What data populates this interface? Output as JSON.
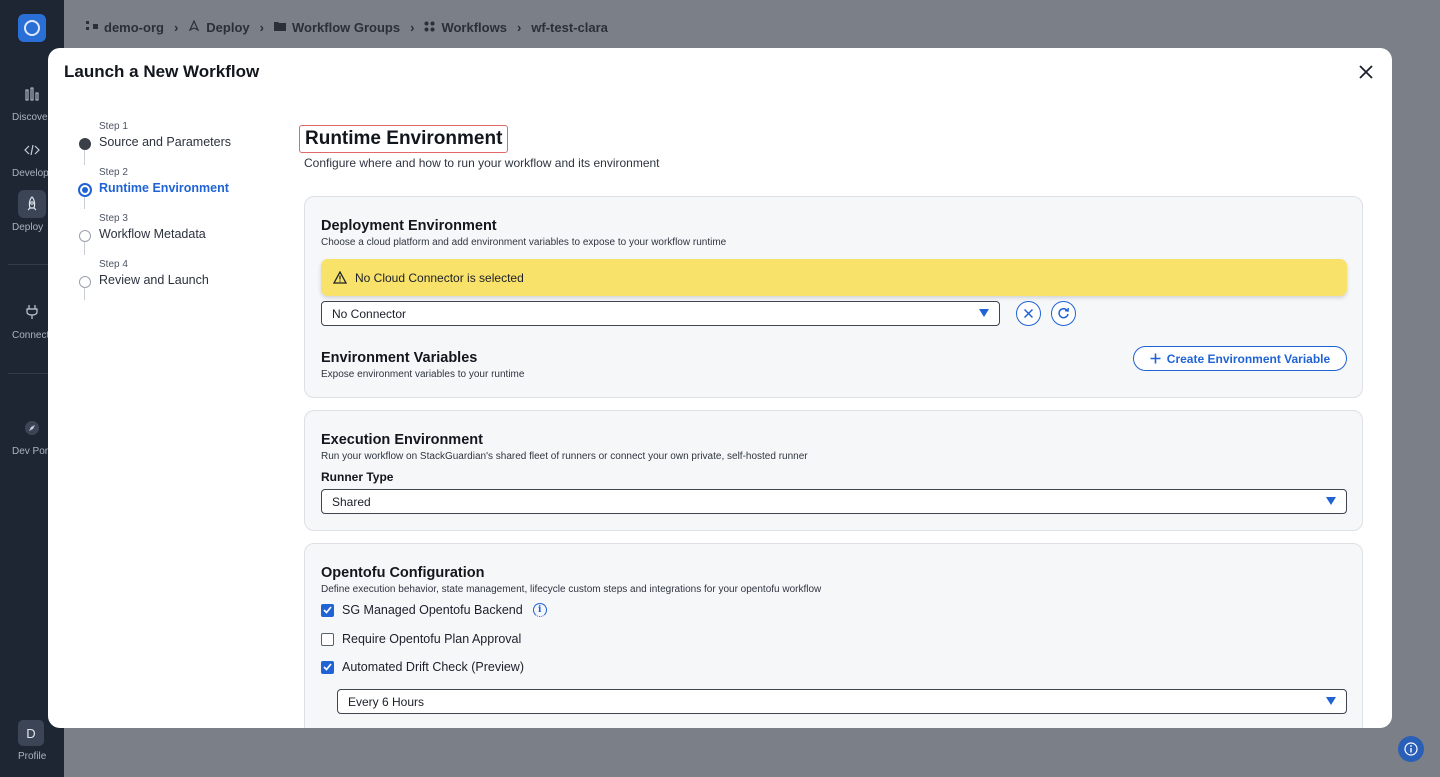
{
  "rail": {
    "items": [
      {
        "label": "Discover",
        "icon": "bar-chart-icon"
      },
      {
        "label": "Develop",
        "icon": "code-icon"
      },
      {
        "label": "Deploy",
        "icon": "rocket-icon"
      },
      {
        "label": "Connectors",
        "icon": "plug-icon"
      },
      {
        "label": "Dev Portal",
        "icon": "compass-icon"
      }
    ],
    "avatar_letter": "D",
    "profile_label": "Profile"
  },
  "breadcrumb": [
    {
      "label": "demo-org",
      "icon": "org-icon"
    },
    {
      "label": "Deploy",
      "icon": "rocket-icon"
    },
    {
      "label": "Workflow Groups",
      "icon": "folder-icon"
    },
    {
      "label": "Workflows",
      "icon": "grid-icon"
    },
    {
      "label": "wf-test-clara",
      "icon": ""
    }
  ],
  "modal": {
    "title": "Launch a New Workflow"
  },
  "steps": [
    {
      "num": "Step 1",
      "label": "Source and Parameters",
      "state": "done"
    },
    {
      "num": "Step 2",
      "label": "Runtime Environment",
      "state": "active"
    },
    {
      "num": "Step 3",
      "label": "Workflow Metadata",
      "state": "pending"
    },
    {
      "num": "Step 4",
      "label": "Review and Launch",
      "state": "pending"
    }
  ],
  "content": {
    "title": "Runtime Environment",
    "subtitle": "Configure where and how to run your workflow and its environment"
  },
  "deployment": {
    "title": "Deployment Environment",
    "desc": "Choose a cloud platform and add environment variables to expose to your workflow runtime",
    "alert": "No Cloud Connector is selected",
    "connector_value": "No Connector",
    "env_title": "Environment Variables",
    "env_desc": "Expose environment variables to your runtime",
    "create_env_label": "Create Environment Variable"
  },
  "execution": {
    "title": "Execution Environment",
    "desc": "Run your workflow on StackGuardian's shared fleet of runners or connect your own private, self-hosted runner",
    "runner_label": "Runner Type",
    "runner_value": "Shared"
  },
  "opentofu": {
    "title": "Opentofu Configuration",
    "desc": "Define execution behavior, state management, lifecycle custom steps and integrations for your opentofu workflow",
    "options": [
      {
        "label": "SG Managed Opentofu Backend",
        "checked": true
      },
      {
        "label": "Require Opentofu Plan Approval",
        "checked": false
      },
      {
        "label": "Automated Drift Check (Preview)",
        "checked": true
      }
    ],
    "drift_interval": "Every 6 Hours"
  },
  "colors": {
    "accent": "#1f63d4",
    "alert_bg": "#f8e26a",
    "title_outline": "#e06a6a"
  }
}
